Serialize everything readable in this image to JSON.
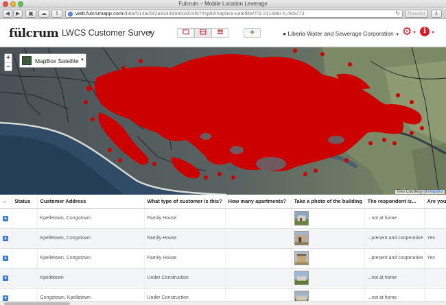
{
  "browser": {
    "window_title": "Fulcrum – Mobile Location Leverage",
    "url_host": "web.fulcrumapp.com",
    "url_path": "/data/514a25f2a934489a53004fd7#split/mapbox-satellite/7/3.151486/-5.405273",
    "reader_label": "Reader",
    "reload_icon": "↻"
  },
  "header": {
    "logo": "fülcrum",
    "survey_title": "LWCS Customer Survey",
    "organization": "Liberia Water and Sewerage Corporation",
    "accent_color": "#d41f2a",
    "add_symbol": "+",
    "view_icons": [
      "book-icon",
      "split-view-icon",
      "list-icon"
    ]
  },
  "map": {
    "zoom_in": "+",
    "zoom_out": "−",
    "layer_name": "MapBox Satellite",
    "attribution_prefix": "Tiles Courtesy of ",
    "attribution_link": "MapBox",
    "marker_color": "#cc0000"
  },
  "table": {
    "columns": [
      "",
      "Status",
      "Customer Address",
      "What type of customer is this?",
      "How many apartments?",
      "Take a photo of the building",
      "The respondent is...",
      "Are you"
    ],
    "rows": [
      {
        "address": "Kpelletown, Congotown",
        "type": "Family House",
        "apartments": "",
        "respondent": "...not at home",
        "are_you": ""
      },
      {
        "address": "Kpelletown, Congotown",
        "type": "Family House",
        "apartments": "",
        "respondent": "...present and cooperative",
        "are_you": "Yes"
      },
      {
        "address": "Kpelletown, Congotown",
        "type": "Family House",
        "apartments": "",
        "respondent": "...present and cooperative",
        "are_you": "Yes"
      },
      {
        "address": "Kpelletown",
        "type": "Under Construction",
        "apartments": "",
        "respondent": "...not at home",
        "are_you": ""
      },
      {
        "address": "Congotown, Kpelletown",
        "type": "Under Construction",
        "apartments": "",
        "respondent": "...not at home",
        "are_you": ""
      }
    ]
  }
}
